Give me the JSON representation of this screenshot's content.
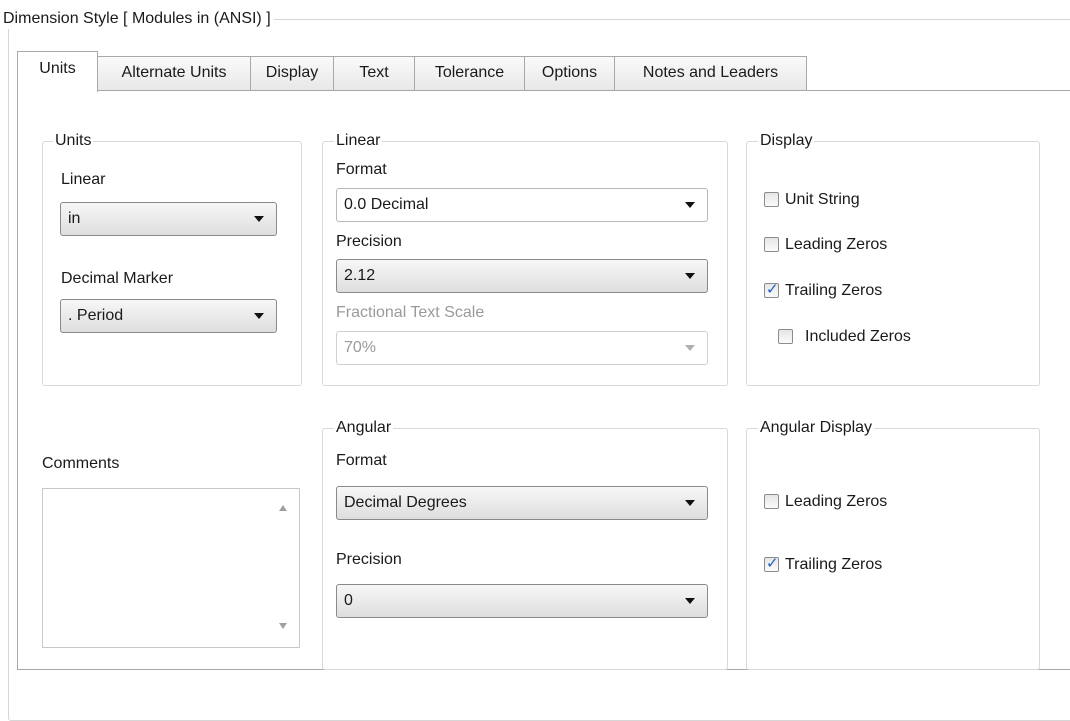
{
  "frame_title": "Dimension Style [ Modules in (ANSI) ]",
  "tabs": [
    "Units",
    "Alternate Units",
    "Display",
    "Text",
    "Tolerance",
    "Options",
    "Notes and Leaders"
  ],
  "active_tab": "Units",
  "units_group": {
    "title": "Units",
    "linear_label": "Linear",
    "linear_value": "in",
    "decimal_marker_label": "Decimal Marker",
    "decimal_marker_value": ". Period"
  },
  "linear_group": {
    "title": "Linear",
    "format_label": "Format",
    "format_value": "0.0 Decimal",
    "precision_label": "Precision",
    "precision_value": "2.12",
    "fractional_label": "Fractional Text Scale",
    "fractional_value": "70%"
  },
  "display_group": {
    "title": "Display",
    "unit_string": {
      "label": "Unit String",
      "checked": false
    },
    "leading_zeros": {
      "label": "Leading Zeros",
      "checked": false
    },
    "trailing_zeros": {
      "label": "Trailing Zeros",
      "checked": true
    },
    "included_zeros": {
      "label": "Included Zeros",
      "checked": false
    }
  },
  "comments": {
    "label": "Comments",
    "value": ""
  },
  "angular_group": {
    "title": "Angular",
    "format_label": "Format",
    "format_value": "Decimal Degrees",
    "precision_label": "Precision",
    "precision_value": "0"
  },
  "angular_display_group": {
    "title": "Angular Display",
    "leading_zeros": {
      "label": "Leading Zeros",
      "checked": false
    },
    "trailing_zeros": {
      "label": "Trailing Zeros",
      "checked": true
    }
  },
  "icons": {
    "dropdown": "chevron-down-icon",
    "check": "checkmark-icon",
    "scroll_up": "scroll-up-icon",
    "scroll_down": "scroll-down-icon"
  }
}
